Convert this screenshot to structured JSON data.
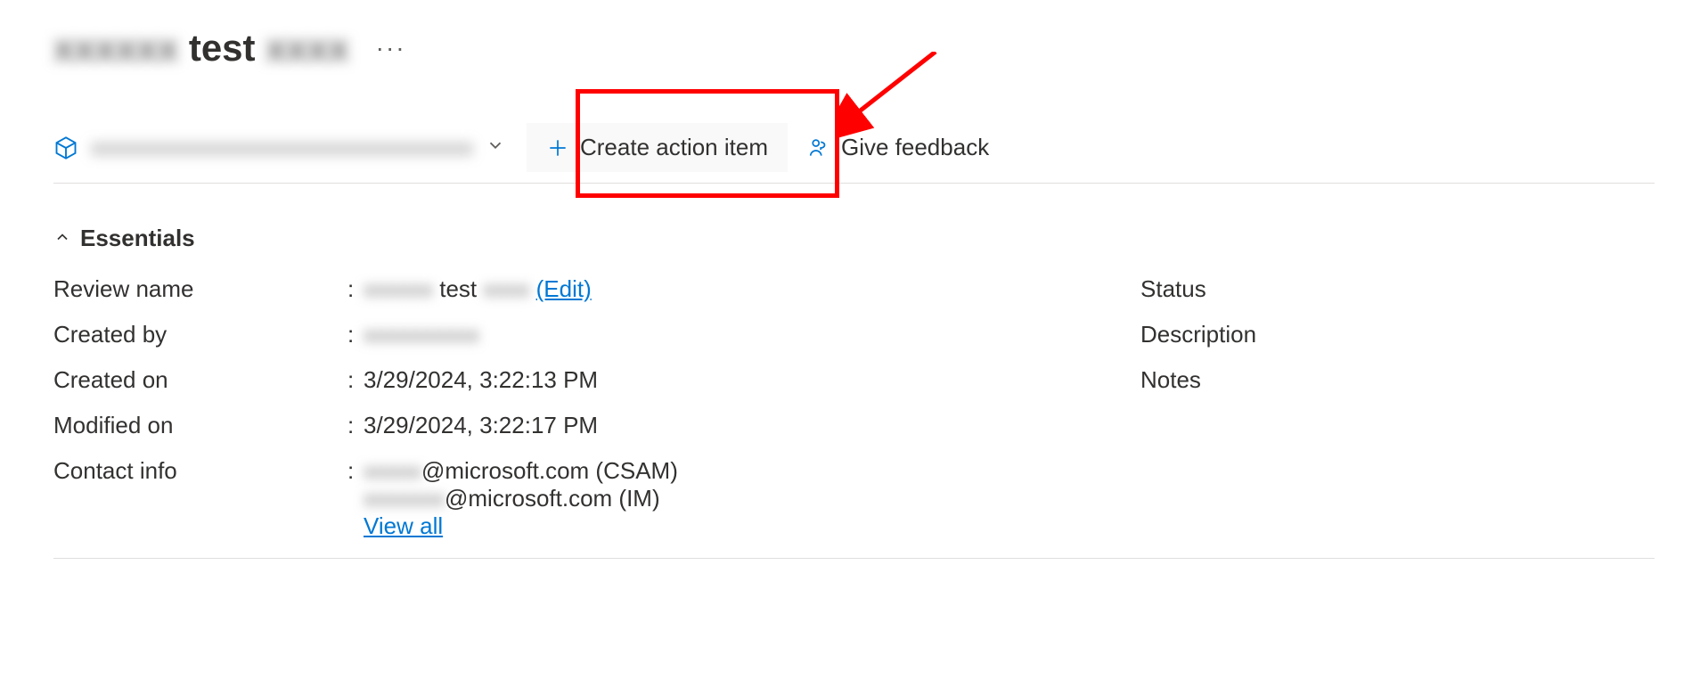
{
  "title": {
    "prefix_hidden": "xxxxxx",
    "visible": "test",
    "suffix_hidden": "xxxx"
  },
  "toolbar": {
    "resource_dropdown_hidden": "xxxxxxxxxxxxxxxxxxxxxxxxxxxxxxxxx",
    "create_action_item": "Create action item",
    "give_feedback": "Give feedback"
  },
  "essentials": {
    "header": "Essentials",
    "left": [
      {
        "key": "Review name",
        "value_prefix_hidden": "xxxxxx",
        "value_visible": "test",
        "value_suffix_hidden": "xxxx",
        "edit_label": "(Edit)"
      },
      {
        "key": "Created by",
        "value_hidden": "xxxxxxxxxx"
      },
      {
        "key": "Created on",
        "value": "3/29/2024, 3:22:13 PM"
      },
      {
        "key": "Modified on",
        "value": "3/29/2024, 3:22:17 PM"
      },
      {
        "key": "Contact info",
        "lines": [
          {
            "prefix_hidden": "xxxxx",
            "value": "@microsoft.com (CSAM)"
          },
          {
            "prefix_hidden": "xxxxxxx",
            "value": "@microsoft.com (IM)"
          }
        ],
        "view_all": "View all"
      }
    ],
    "right": [
      {
        "key": "Status"
      },
      {
        "key": "Description"
      },
      {
        "key": "Notes"
      }
    ]
  },
  "annotation": {
    "target": "create-action-item-button"
  }
}
